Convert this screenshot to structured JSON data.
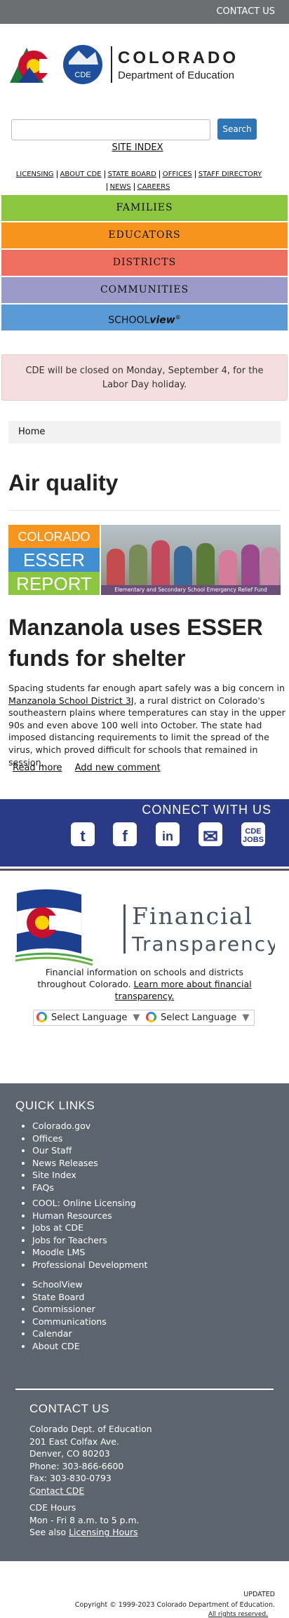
{
  "topbar": {
    "contact_label": "CONTACT US"
  },
  "logo": {
    "line1": "COLORADO",
    "line2": "Department of Education",
    "badge": "CDE"
  },
  "search": {
    "button_label": "Search",
    "value": "",
    "placeholder": ""
  },
  "site_index_label": "SITE INDEX",
  "utility_nav": {
    "row1": [
      "LICENSING",
      "ABOUT CDE",
      "STATE BOARD",
      "OFFICES",
      "STAFF DIRECTORY"
    ],
    "row2": [
      "NEWS",
      "CAREERS"
    ]
  },
  "main_menu": {
    "families": "FAMILIES",
    "educators": "EDUCATORS",
    "districts": "DISTRICTS",
    "communities": "COMMUNITIES",
    "schoolview_a": "SCHOOL",
    "schoolview_b": "view",
    "schoolview_mark": "®"
  },
  "alert_text": "CDE will be closed on Monday, September 4, for the Labor Day holiday.",
  "breadcrumb": {
    "home": "Home"
  },
  "page_title": "Air quality",
  "esser_banner": {
    "word1": "COLORADO",
    "word2": "ESSER",
    "word3": "REPORT",
    "caption": "Elementary and Secondary School Emergency Relief Fund"
  },
  "article": {
    "title": "Manzanola uses ESSER funds for shelter",
    "body_before": "Spacing students far enough apart safely was a big concern in ",
    "body_link": "Manzanola School District 3J",
    "body_after": ", a rural district on Colorado's southeastern plains where temperatures can stay in the upper 90s and even above 100 well into October. The state had imposed distancing requirements to limit the spread of the virus, which proved difficult for schools that remained in session.",
    "read_more": "Read more",
    "add_comment": "Add new comment"
  },
  "connect": {
    "title": "CONNECT WITH US",
    "twitter": "t",
    "facebook": "f",
    "linkedin": "in",
    "email": "✉",
    "jobs_a": "CDE",
    "jobs_b": "JOBS"
  },
  "financial": {
    "word1": "Financial",
    "word2": "Transparency",
    "text": "Financial information on schools and districts throughout Colorado.",
    "link": "Learn more about financial transparency.",
    "translate_label": "Select Language",
    "caret": "▼"
  },
  "quick_links": {
    "title": "QUICK LINKS",
    "group1": [
      "Colorado.gov",
      "Offices",
      "Our Staff",
      "News Releases",
      "Site Index",
      "FAQs"
    ],
    "group2": [
      "COOL: Online Licensing",
      "Human Resources",
      "Jobs at CDE",
      "Jobs for Teachers",
      "Moodle LMS",
      "Professional Development"
    ],
    "group3": [
      "SchoolView",
      "State Board",
      "Commissioner",
      "Communications",
      "Calendar",
      "About CDE"
    ]
  },
  "contact": {
    "title": "CONTACT US",
    "lines": [
      "Colorado Dept. of Education",
      "201 East Colfax Ave.",
      "Denver, CO 80203",
      "Phone: 303-866-6600",
      "Fax: 303-830-0793"
    ],
    "contact_link": "Contact CDE",
    "hours_title": "CDE Hours",
    "hours": "Mon - Fri 8 a.m. to 5 p.m.",
    "see_also": "See also ",
    "licensing_hours": "Licensing Hours"
  },
  "bottom": {
    "updated": "UPDATED",
    "copyright": "Copyright © 1999-2023 Colorado Department of Education.",
    "partial": "All rights reserved."
  }
}
